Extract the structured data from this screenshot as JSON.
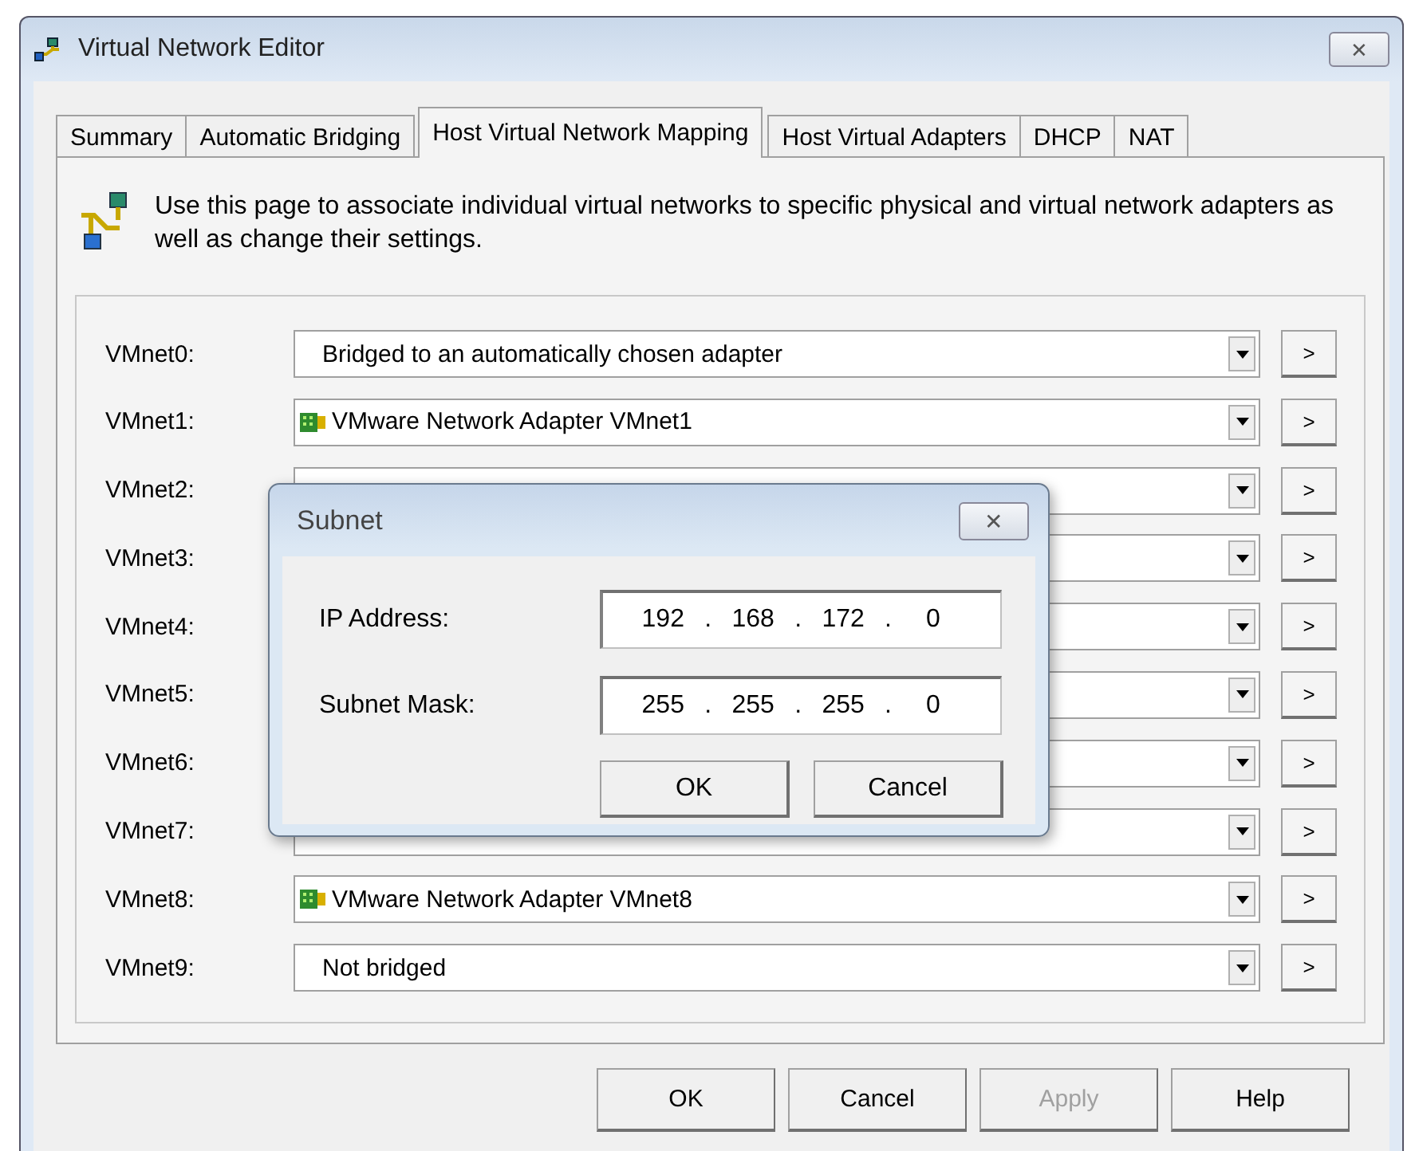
{
  "window": {
    "title": "Virtual Network Editor",
    "close": "✕"
  },
  "tabs": [
    {
      "label": "Summary",
      "selected": false
    },
    {
      "label": "Automatic Bridging",
      "selected": false
    },
    {
      "label": "Host Virtual Network Mapping",
      "selected": true
    },
    {
      "label": "Host Virtual Adapters",
      "selected": false
    },
    {
      "label": "DHCP",
      "selected": false
    },
    {
      "label": "NAT",
      "selected": false
    }
  ],
  "intro": "Use this page to associate individual virtual networks to specific physical and virtual network adapters as well as change their settings.",
  "networks": [
    {
      "label": "VMnet0:",
      "value": "Bridged to an automatically chosen adapter",
      "kind": "plain",
      "more": ">"
    },
    {
      "label": "VMnet1:",
      "value": "VMware Network Adapter VMnet1",
      "kind": "adapter",
      "more": ">"
    },
    {
      "label": "VMnet2:",
      "kind": "hidden",
      "more": ">"
    },
    {
      "label": "VMnet3:",
      "kind": "hidden",
      "more": ">"
    },
    {
      "label": "VMnet4:",
      "kind": "hidden",
      "more": ">"
    },
    {
      "label": "VMnet5:",
      "kind": "hidden",
      "more": ">"
    },
    {
      "label": "VMnet6:",
      "kind": "hidden",
      "more": ">"
    },
    {
      "label": "VMnet7:",
      "kind": "hidden",
      "more": ">"
    },
    {
      "label": "VMnet8:",
      "value": "VMware Network Adapter VMnet8",
      "kind": "adapter",
      "more": ">"
    },
    {
      "label": "VMnet9:",
      "value": "Not bridged",
      "kind": "plain",
      "more": ">"
    }
  ],
  "subnet_dialog": {
    "title": "Subnet",
    "close": "✕",
    "fields": [
      {
        "label": "IP Address:",
        "octets": [
          "192",
          "168",
          "172",
          "0"
        ],
        "separators": [
          ".",
          ".",
          "."
        ]
      },
      {
        "label": "Subnet Mask:",
        "octets": [
          "255",
          "255",
          "255",
          "0"
        ],
        "separators": [
          ".",
          ".",
          "."
        ]
      }
    ],
    "buttons": [
      "OK",
      "Cancel"
    ]
  },
  "buttons": [
    {
      "label": "OK",
      "disabled": false
    },
    {
      "label": "Cancel",
      "disabled": false
    },
    {
      "label": "Apply",
      "disabled": true
    },
    {
      "label": "Help",
      "disabled": false
    }
  ]
}
